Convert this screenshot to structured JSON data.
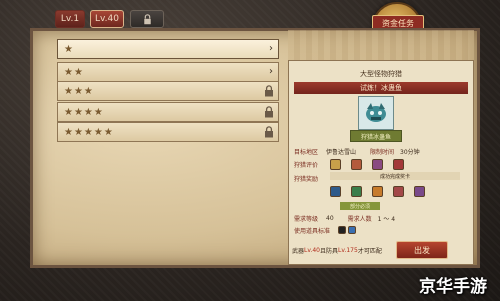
{
  "tabs": [
    {
      "label": "Lv.1"
    },
    {
      "label": "Lv.40"
    },
    {
      "label": "🔒"
    }
  ],
  "badge_label": "资金任务",
  "quests": [
    {
      "stars": "★",
      "end": "›",
      "locked": false
    },
    {
      "stars": "★★",
      "end": "›",
      "locked": false
    },
    {
      "stars": "★★★",
      "end": "",
      "locked": true
    },
    {
      "stars": "★★★★",
      "end": "",
      "locked": true
    },
    {
      "stars": "★★★★★",
      "end": "",
      "locked": true
    }
  ],
  "detail": {
    "quest_type": "大型怪物狩猎",
    "target_title": "试炼！冰蛊鱼",
    "monster_name": "狩猎冰蛊鱼",
    "area_label": "目标地区",
    "area_value": "伊鲁达雪山",
    "time_label": "限制时间",
    "time_value": "30分钟",
    "rating_label": "狩猎评价",
    "reward_label": "狩猎奖励",
    "condition": "成功完成奖卡",
    "sub_band": "部分必须",
    "level_label": "需求等级",
    "level_value": "40",
    "people_label": "需求人数",
    "people_value": "1 ～ 4",
    "item_label": "使用道具标准"
  },
  "footer": {
    "weapon_prefix": "武器",
    "weapon_req": "Lv.40",
    "mid": "且防具",
    "armor_req": "Lv.175",
    "suffix": "才可匹配"
  },
  "depart_label": "出发",
  "watermark": "京华手游",
  "colors": {
    "accent_red": "#8e2c22",
    "parchment": "#e8d7b4",
    "gold": "#e7c16a"
  }
}
